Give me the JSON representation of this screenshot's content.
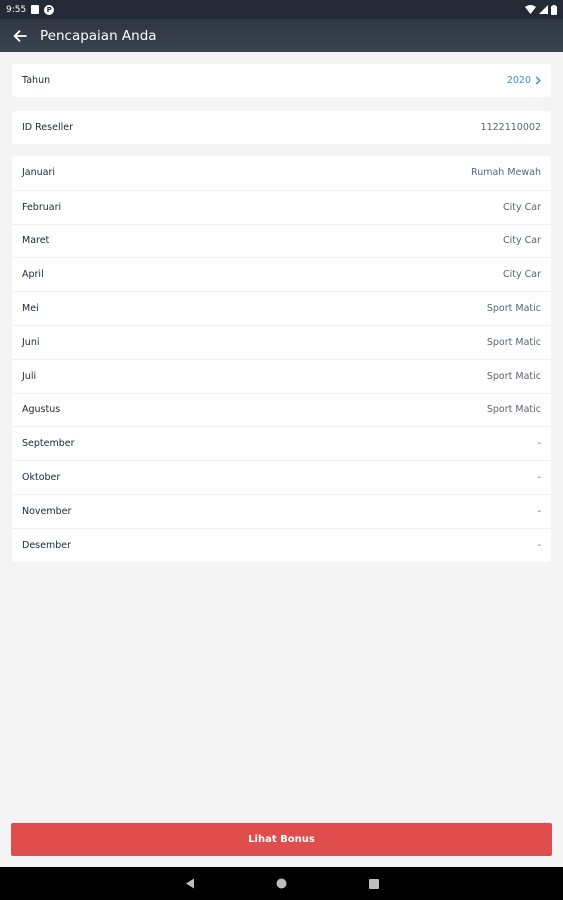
{
  "status_bar": {
    "time": "9:55",
    "icons": [
      "sd-card-icon",
      "notification-icon",
      "wifi-icon",
      "signal-icon",
      "battery-icon"
    ]
  },
  "app_bar": {
    "title": "Pencapaian Anda",
    "back_icon": "arrow-left-icon"
  },
  "year_card": {
    "label": "Tahun",
    "value": "2020",
    "accent": "#3b8fd8"
  },
  "reseller_card": {
    "label": "ID Reseller",
    "value": "1122110002"
  },
  "months": [
    {
      "label": "Januari",
      "value": "Rumah Mewah"
    },
    {
      "label": "Februari",
      "value": "City Car"
    },
    {
      "label": "Maret",
      "value": "City Car"
    },
    {
      "label": "April",
      "value": "City Car"
    },
    {
      "label": "Mei",
      "value": "Sport Matic"
    },
    {
      "label": "Juni",
      "value": "Sport Matic"
    },
    {
      "label": "Juli",
      "value": "Sport Matic"
    },
    {
      "label": "Agustus",
      "value": "Sport Matic"
    },
    {
      "label": "September",
      "value": "-"
    },
    {
      "label": "Oktober",
      "value": "-"
    },
    {
      "label": "November",
      "value": "-"
    },
    {
      "label": "Desember",
      "value": "-"
    }
  ],
  "button": {
    "label": "Lihat Bonus",
    "color": "#e04d4d"
  },
  "nav_bar": {
    "icons": [
      "back-triangle-icon",
      "home-circle-icon",
      "recents-square-icon"
    ]
  }
}
